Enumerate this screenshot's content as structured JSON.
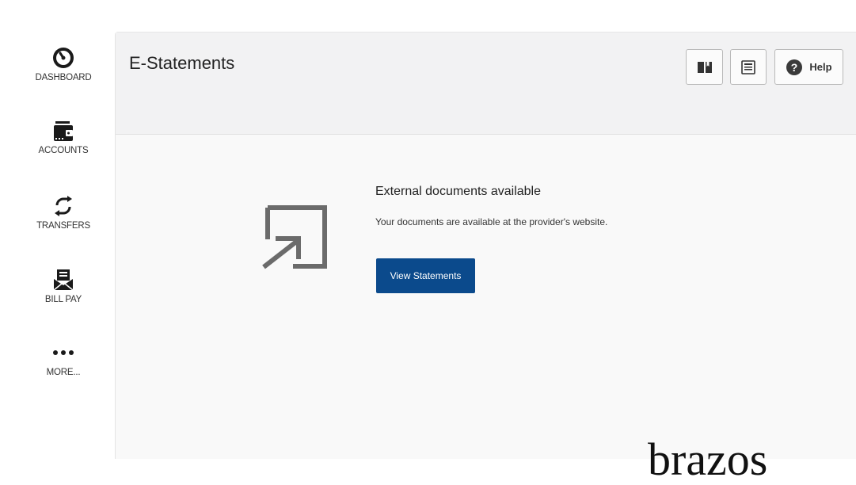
{
  "sidebar": {
    "items": [
      {
        "label": "DASHBOARD",
        "icon": "gauge-icon"
      },
      {
        "label": "ACCOUNTS",
        "icon": "wallet-icon"
      },
      {
        "label": "TRANSFERS",
        "icon": "transfer-arrows-icon"
      },
      {
        "label": "BILL PAY",
        "icon": "bill-envelope-icon"
      },
      {
        "label": "MORE...",
        "icon": "more-dots-icon"
      }
    ]
  },
  "header": {
    "title": "E-Statements",
    "help_label": "Help"
  },
  "main": {
    "heading": "External documents available",
    "description": "Your documents are available at the provider's website.",
    "button_label": "View Statements"
  },
  "footer": {
    "brand_text": "brazos"
  },
  "colors": {
    "primary_button": "#0b4a8c",
    "panel_bg": "#f9f9f9",
    "header_bg": "#f2f2f3",
    "icon_gray": "#6b6b6b"
  }
}
